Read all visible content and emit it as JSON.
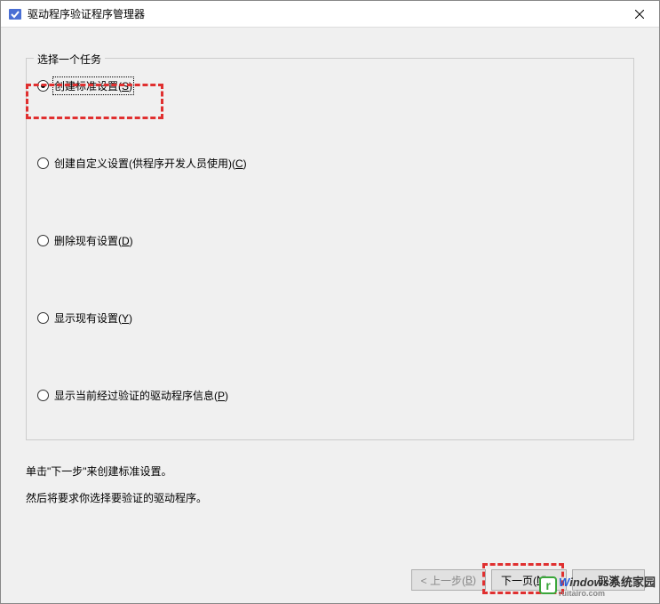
{
  "window": {
    "title": "驱动程序验证程序管理器"
  },
  "group": {
    "label": "选择一个任务"
  },
  "radios": {
    "r1": {
      "label_pre": "创建标准设置(",
      "mnemonic": "S",
      "label_post": ")",
      "selected": true
    },
    "r2": {
      "label_pre": "创建自定义设置(供程序开发人员使用)(",
      "mnemonic": "C",
      "label_post": ")",
      "selected": false
    },
    "r3": {
      "label_pre": "删除现有设置(",
      "mnemonic": "D",
      "label_post": ")",
      "selected": false
    },
    "r4": {
      "label_pre": "显示现有设置(",
      "mnemonic": "Y",
      "label_post": ")",
      "selected": false
    },
    "r5": {
      "label_pre": "显示当前经过验证的驱动程序信息(",
      "mnemonic": "P",
      "label_post": ")",
      "selected": false
    }
  },
  "instructions": {
    "line1": "单击\"下一步\"来创建标准设置。",
    "line2": "然后将要求你选择要验证的驱动程序。"
  },
  "buttons": {
    "back": {
      "pre": "< 上一步(",
      "mnemonic": "B",
      "post": ")"
    },
    "next": {
      "pre": "下一页(",
      "mnemonic": "N",
      "post": ") >"
    },
    "cancel": "取消"
  },
  "watermark": {
    "logo_letter": "r",
    "brand_first": "W",
    "brand_rest": "indows",
    "brand_cn": "系统家园",
    "sub": "ruitairo.com"
  }
}
